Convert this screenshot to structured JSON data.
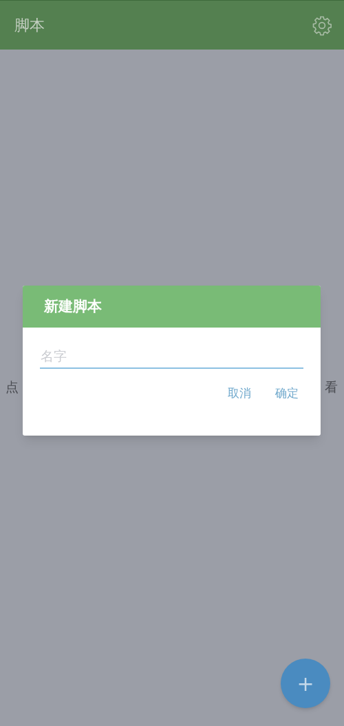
{
  "app_bar": {
    "title": "脚本"
  },
  "empty_hint": {
    "left_part": "点",
    "right_part": "看"
  },
  "dialog": {
    "title": "新建脚本",
    "name_field": {
      "placeholder": "名字"
    },
    "buttons": [
      "取消",
      "确定"
    ]
  },
  "fab": {
    "label": "+"
  }
}
